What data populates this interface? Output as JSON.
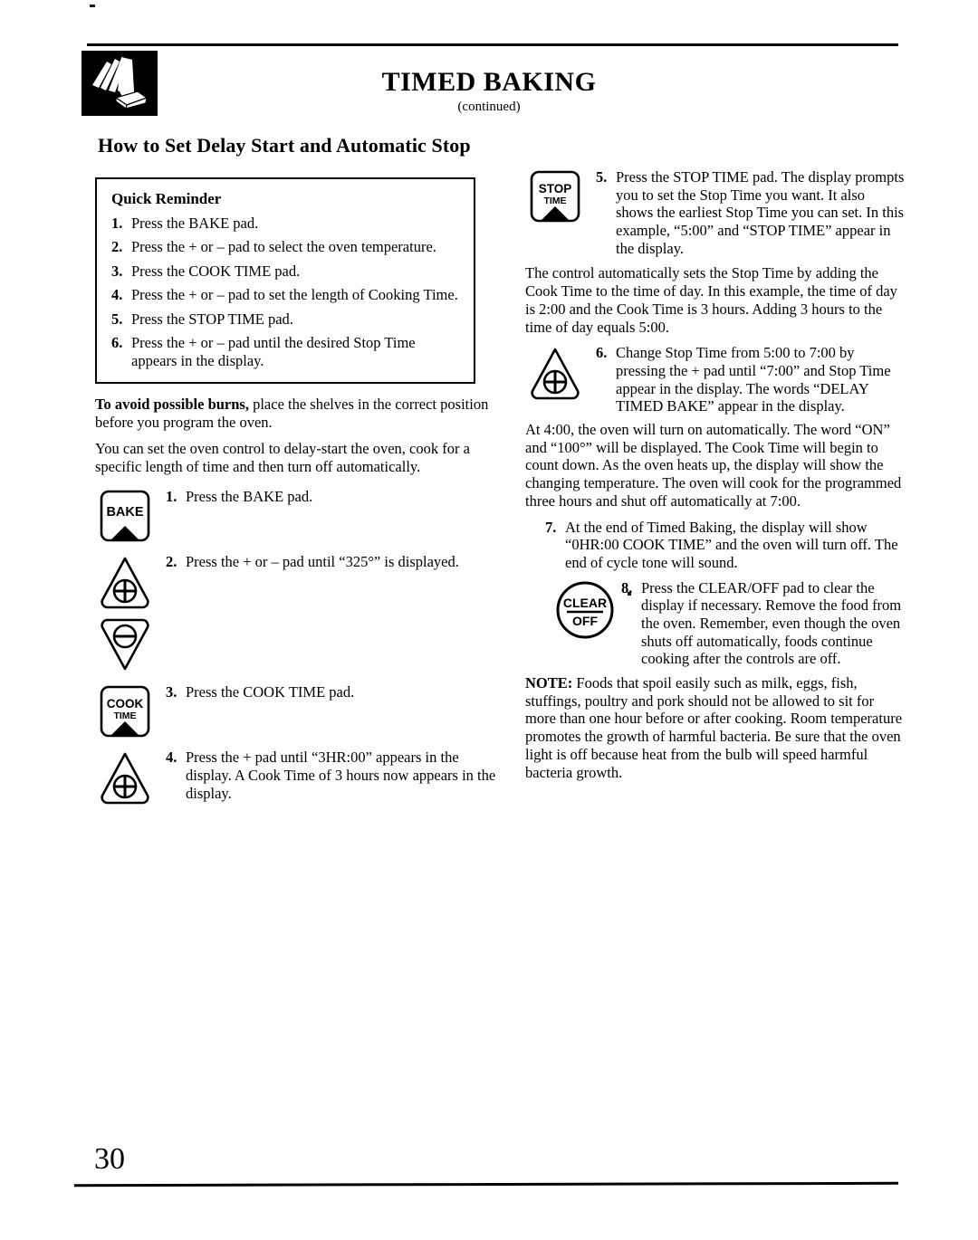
{
  "header": {
    "title": "TIMED BAKING",
    "subtitle": "(continued)",
    "icon": "hand-pressing-pad-icon"
  },
  "section_heading": "How to Set Delay Start and Automatic Stop",
  "quick_reminder": {
    "title": "Quick Reminder",
    "steps": [
      {
        "num": "1.",
        "text": "Press the BAKE pad."
      },
      {
        "num": "2.",
        "text": "Press the + or – pad to select the oven temperature."
      },
      {
        "num": "3.",
        "text": "Press the COOK TIME pad."
      },
      {
        "num": "4.",
        "text": "Press the + or – pad to set the length of Cooking Time."
      },
      {
        "num": "5.",
        "text": "Press the STOP TIME pad."
      },
      {
        "num": "6.",
        "text": "Press the + or – pad until the desired Stop Time appears in the display."
      }
    ]
  },
  "left_column": {
    "warning_lead": "To avoid possible burns,",
    "warning_rest": " place the shelves in the correct position before you program the oven.",
    "intro_paragraph": "You can set the oven control to delay-start the oven, cook for a specific length of time and then turn off automatically.",
    "steps": [
      {
        "num": "1.",
        "text": "Press the BAKE pad.",
        "pad": {
          "kind": "rect-pad",
          "name": "bake-pad",
          "line1": "BAKE",
          "line2": ""
        }
      },
      {
        "num": "2.",
        "text": "Press the + or – pad until “325°” is displayed.",
        "pad": {
          "kind": "plus-pad",
          "name": "plus-pad",
          "glyph": "+"
        },
        "pad2": {
          "kind": "minus-pad",
          "name": "minus-pad",
          "glyph": "–"
        }
      },
      {
        "num": "3.",
        "text": "Press the COOK TIME pad.",
        "pad": {
          "kind": "rect-pad",
          "name": "cook-time-pad",
          "line1": "COOK",
          "line2": "TIME"
        }
      },
      {
        "num": "4.",
        "text": "Press the + pad until “3HR:00” appears in the display. A Cook Time of 3 hours now appears in the display.",
        "pad": {
          "kind": "plus-pad",
          "name": "plus-pad",
          "glyph": "+"
        }
      }
    ]
  },
  "right_column": {
    "steps": [
      {
        "num": "5.",
        "text": "Press the STOP TIME pad. The display prompts you to set the Stop Time you want. It also shows the earliest Stop Time you can set. In this example, “5:00” and “STOP TIME” appear in the display.",
        "pad": {
          "kind": "rect-pad",
          "name": "stop-time-pad",
          "line1": "STOP",
          "line2": "TIME"
        }
      },
      {
        "num": "6.",
        "text": "Change Stop Time from 5:00 to 7:00 by pressing the + pad until “7:00” and Stop Time appear in the display. The words “DELAY TIMED BAKE” appear in the display.",
        "pad": {
          "kind": "plus-pad",
          "name": "plus-pad",
          "glyph": "+"
        }
      },
      {
        "num": "7.",
        "text": "At the end of Timed Baking, the display will show “0HR:00 COOK TIME” and the oven will turn off. The end of cycle tone will sound.",
        "pad": null
      },
      {
        "num": "8.",
        "text": "Press the CLEAR/OFF pad to clear the display if necessary. Remove the food from the oven. Remember, even though the oven shuts off automatically, foods continue cooking after the controls are off.",
        "pad": {
          "kind": "circle-pad",
          "name": "clear-off-pad",
          "line1": "CLEAR",
          "line2": "OFF"
        }
      }
    ],
    "paragraph_stop_time": "The control automatically sets the Stop Time by adding the Cook Time to the time of day. In this example, the time of day is 2:00 and the Cook Time is 3 hours. Adding 3 hours to the time of day equals 5:00.",
    "paragraph_four_oclock": "At 4:00, the oven will turn on automatically. The word “ON” and “100°” will be displayed. The Cook Time will begin to count down. As the oven heats up, the display will show the changing temperature. The oven will cook for the programmed three hours and shut off automatically at 7:00.",
    "note_lead": "NOTE:",
    "note_rest": " Foods that spoil easily such as milk, eggs, fish, stuffings, poultry and pork should not be allowed to sit for more than one hour before or after cooking. Room temperature promotes the growth of harmful bacteria. Be sure that the oven light is off because heat from the bulb will speed harmful bacteria growth."
  },
  "footer": {
    "page_number": "30"
  },
  "colors": {
    "ink": "#000000",
    "paper": "#ffffff"
  }
}
